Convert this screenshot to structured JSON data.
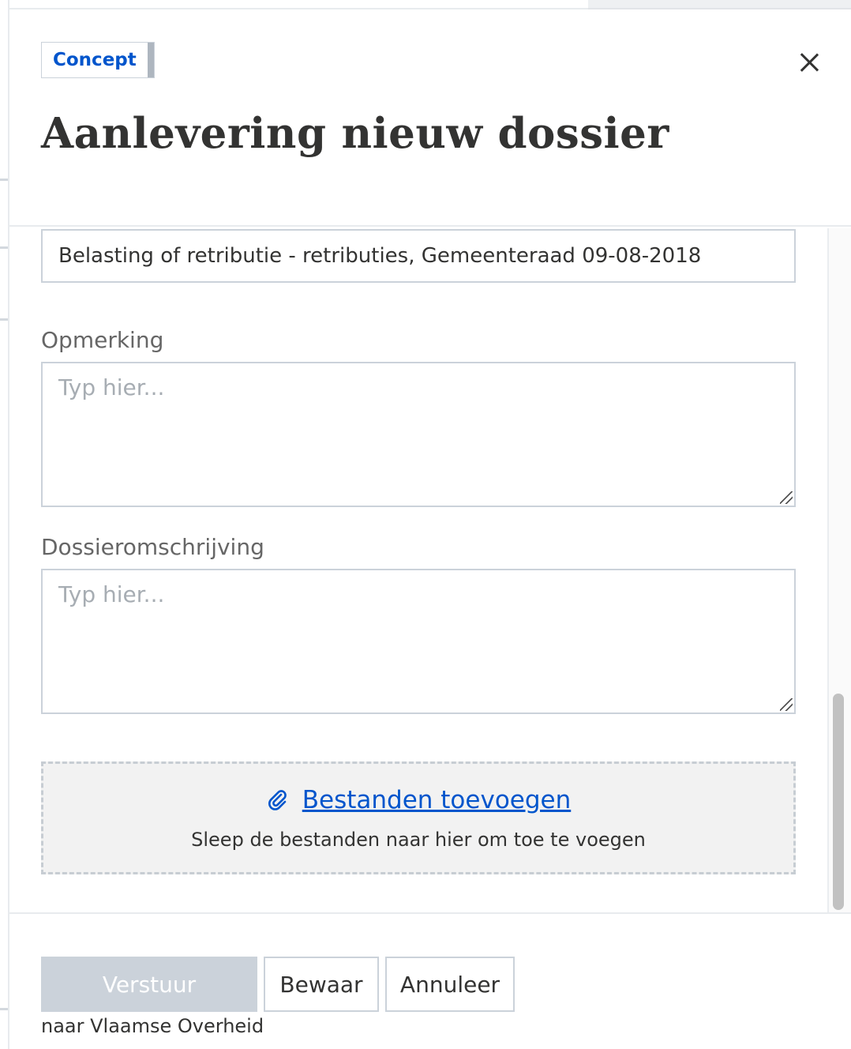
{
  "header": {
    "status_badge": "Concept",
    "title": "Aanlevering nieuw dossier",
    "close_icon": "close-icon"
  },
  "form": {
    "subject_value": "Belasting of retributie - retributies, Gemeenteraad 09-08-2018",
    "remark": {
      "label": "Opmerking",
      "placeholder": "Typ hier..."
    },
    "description": {
      "label": "Dossieromschrijving",
      "placeholder": "Typ hier..."
    },
    "upload": {
      "icon": "paperclip-icon",
      "link_label": "Bestanden toevoegen",
      "hint": "Sleep de bestanden naar hier om toe te voegen"
    }
  },
  "footer": {
    "send_label": "Verstuur",
    "send_caption": "naar Vlaamse Overheid",
    "save_label": "Bewaar",
    "cancel_label": "Annuleer"
  },
  "colors": {
    "accent": "#0055cc",
    "text": "#333332",
    "border": "#cbd2da",
    "disabled_button": "#cbd2da",
    "dropzone_bg": "#f2f2f2"
  }
}
